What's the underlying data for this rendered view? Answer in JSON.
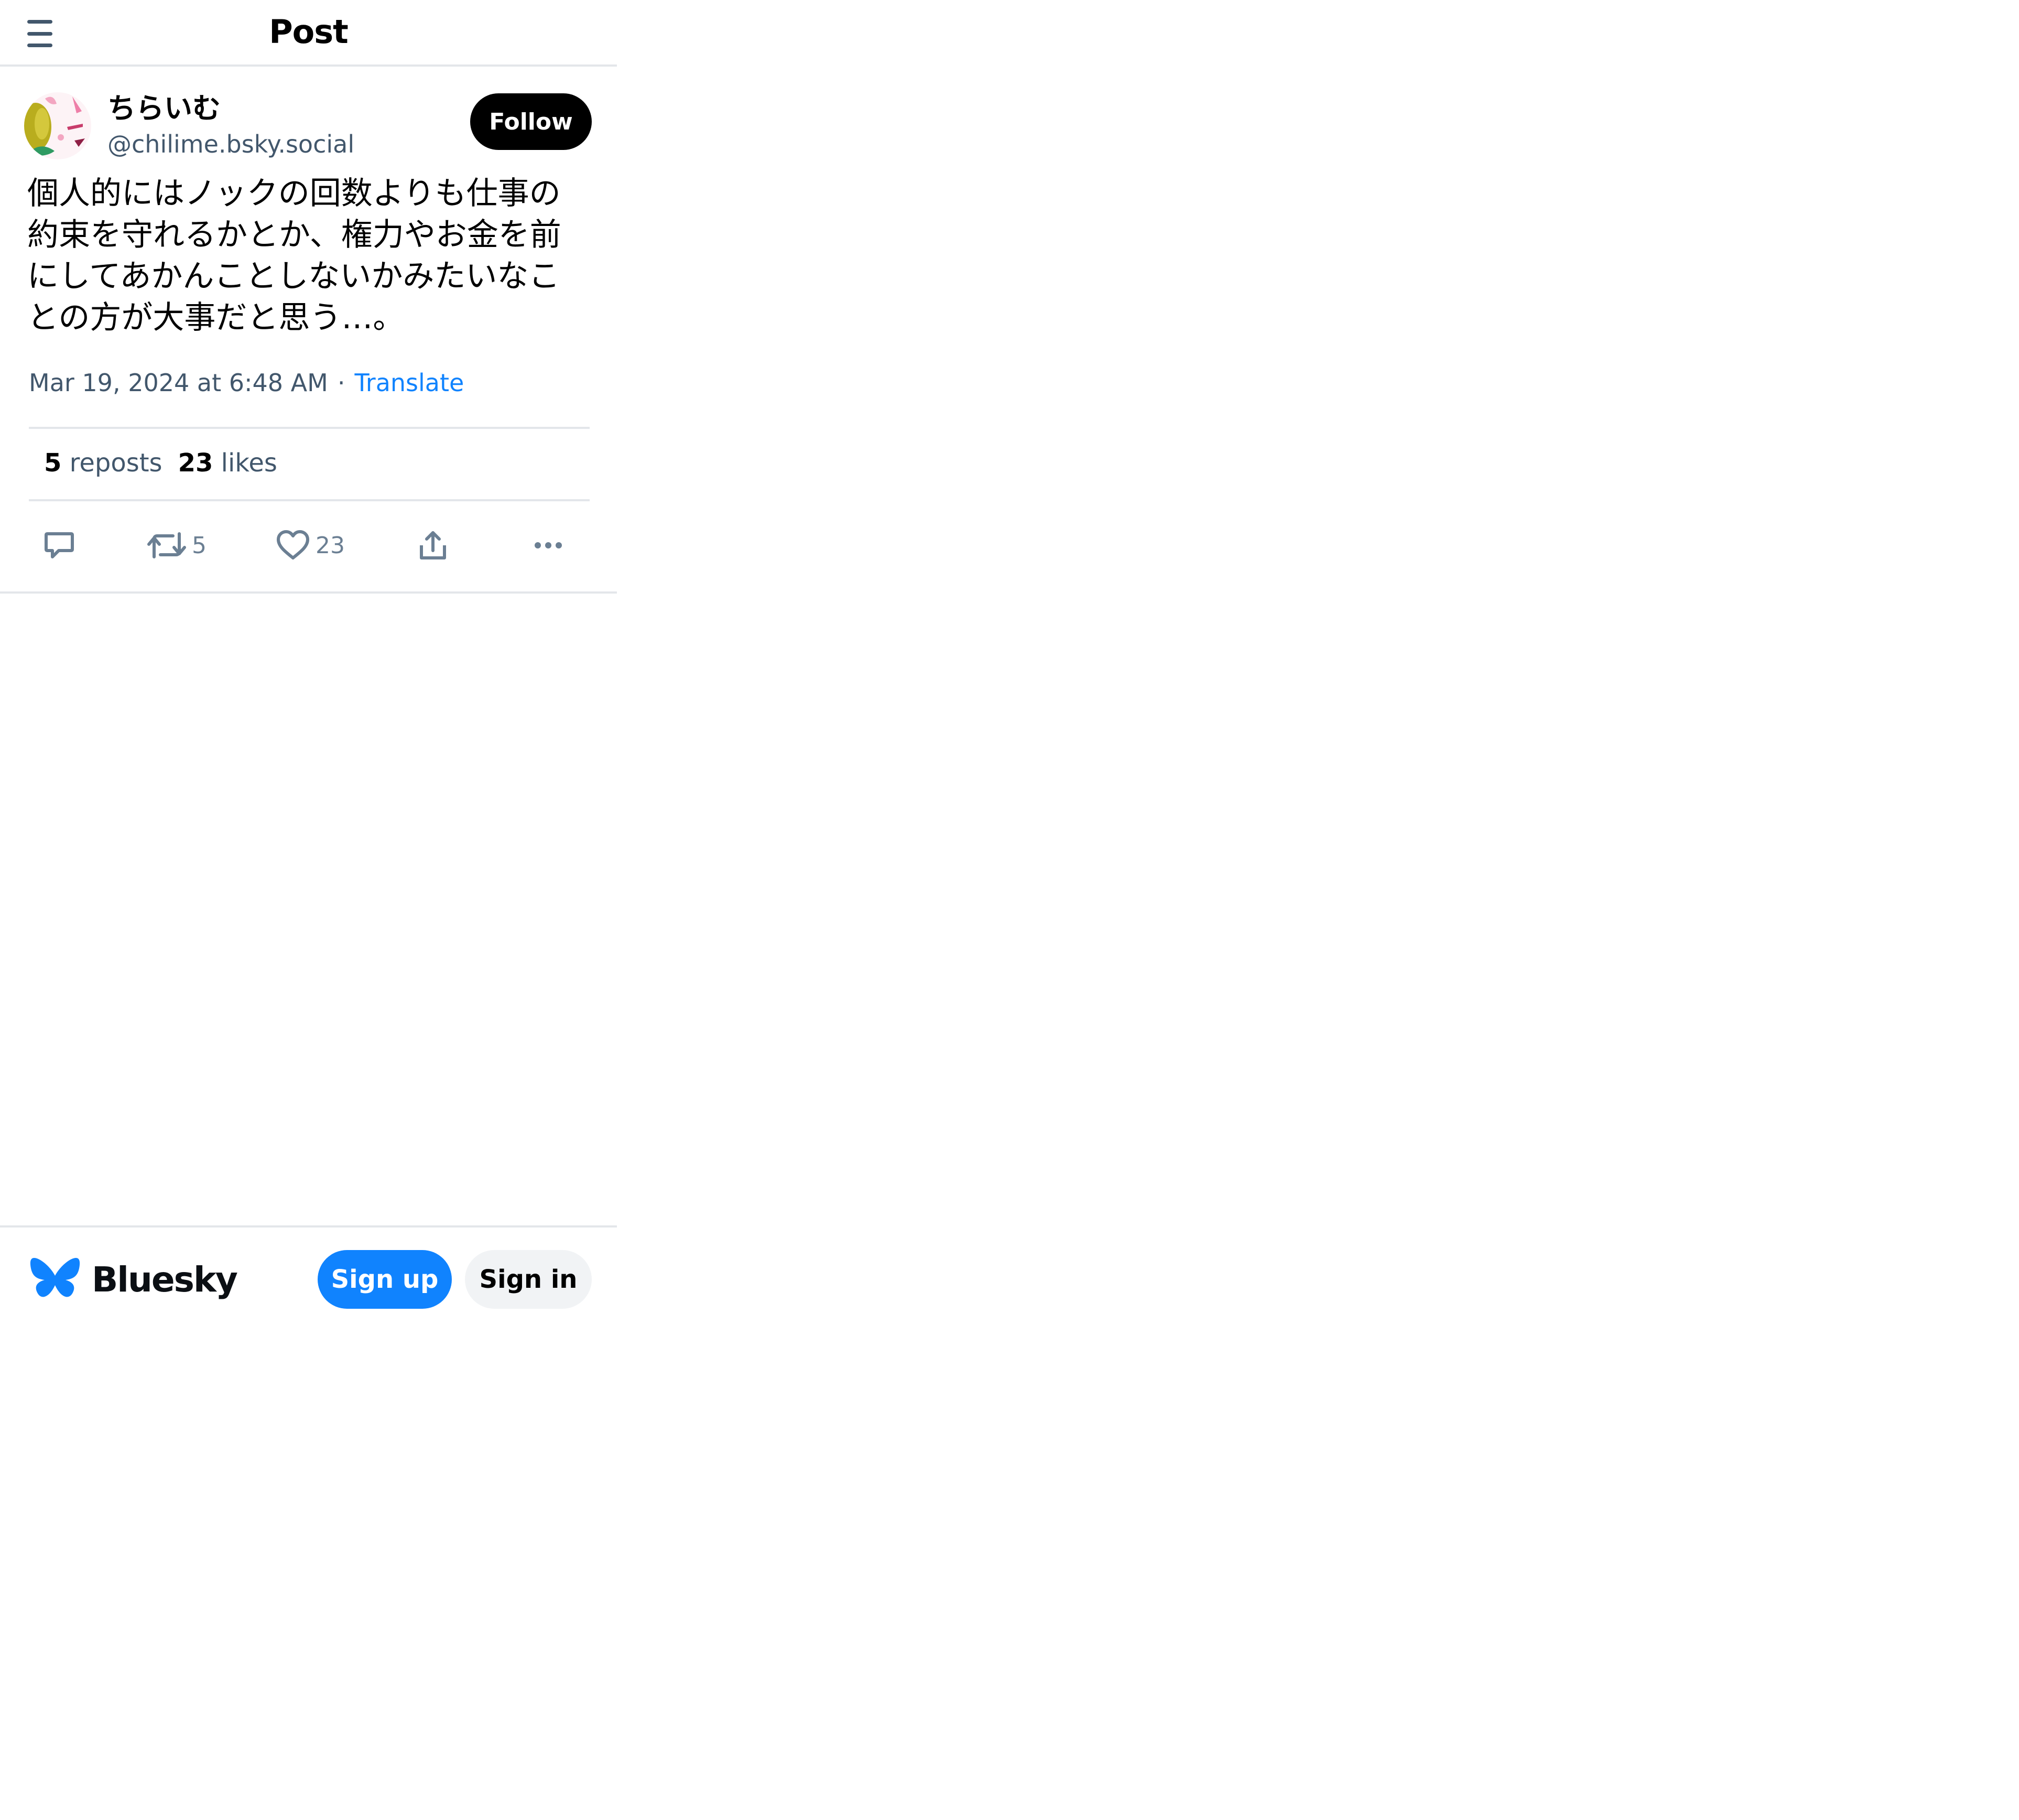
{
  "header": {
    "title": "Post",
    "menu_icon": "hamburger-menu-icon"
  },
  "post": {
    "author": {
      "display_name": "ちらいむ",
      "handle": "@chilime.bsky.social",
      "avatar": "avatar-image"
    },
    "follow_label": "Follow",
    "text": "個人的にはノックの回数よりも仕事の約束を守れるかとか、権力やお金を前にしてあかんことしないかみたいなことの方が大事だと思う…。",
    "timestamp": "Mar 19, 2024 at 6:48 AM",
    "separator": "·",
    "translate_label": "Translate",
    "stats": {
      "reposts_count": "5",
      "reposts_label": "reposts",
      "likes_count": "23",
      "likes_label": "likes"
    },
    "actions": {
      "reply_icon": "comment-bubble-icon",
      "repost_icon": "repost-arrows-icon",
      "repost_count": "5",
      "like_icon": "heart-icon",
      "like_count": "23",
      "share_icon": "share-upload-icon",
      "more_icon": "ellipsis-icon"
    }
  },
  "footer": {
    "brand_name": "Bluesky",
    "brand_icon": "butterfly-logo-icon",
    "signup_label": "Sign up",
    "signin_label": "Sign in"
  },
  "colors": {
    "accent_blue": "#1083fe",
    "text_secondary": "#42576c",
    "icon_gray": "#6b7f93",
    "border": "#e3e6ea",
    "signin_bg": "#f1f3f5"
  }
}
